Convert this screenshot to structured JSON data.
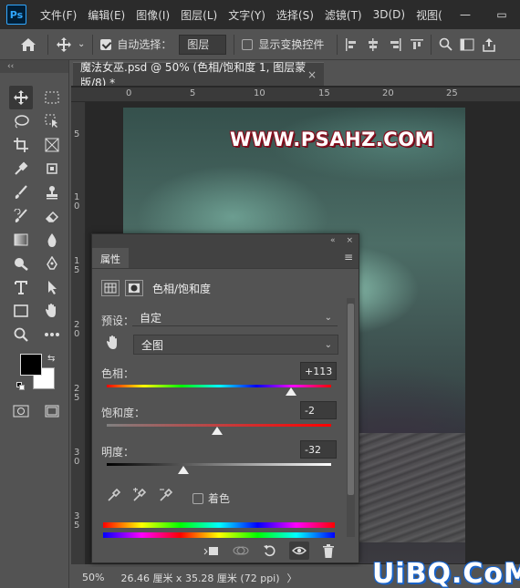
{
  "app": {
    "logo": "Ps"
  },
  "menu": [
    "文件(F)",
    "编辑(E)",
    "图像(I)",
    "图层(L)",
    "文字(Y)",
    "选择(S)",
    "滤镜(T)",
    "3D(D)",
    "视图("
  ],
  "window": {
    "minimize": "—",
    "maximize": "▭"
  },
  "options": {
    "auto_select_label": "自动选择：",
    "auto_select_value": "图层",
    "show_transform_label": "显示变换控件"
  },
  "document": {
    "tab_title": "魔法女巫.psd @ 50% (色相/饱和度 1, 图层蒙版/8) *",
    "close": "×"
  },
  "rulers": {
    "top": [
      "0",
      "5",
      "10",
      "15",
      "20",
      "25"
    ],
    "left": [
      "5",
      "1\n0",
      "1\n5",
      "2\n0",
      "2\n5",
      "3\n0",
      "3\n5"
    ]
  },
  "canvas": {
    "watermark": "WWW.PSAHZ.COM"
  },
  "status": {
    "zoom": "50%",
    "doc_size": "26.46 厘米 x 35.28 厘米 (72 ppi)",
    "arrow": "〉"
  },
  "overlay_watermark": "UiBQ.CoM",
  "properties": {
    "tab_label": "属性",
    "collapse": "«",
    "close": "×",
    "menu": "≡",
    "adjustment_title": "色相/饱和度",
    "preset_label": "预设：",
    "preset_value": "自定",
    "channel_value": "全图",
    "hue_label": "色相：",
    "hue_value": "+113",
    "saturation_label": "饱和度：",
    "saturation_value": "-2",
    "lightness_label": "明度：",
    "lightness_value": "-32",
    "colorize_label": "着色",
    "sliders": {
      "hue_fraction": 0.82,
      "saturation_fraction": 0.49,
      "lightness_fraction": 0.34
    }
  },
  "colors": {
    "accent": "#31a8ff",
    "watermark_red": "#8b1020",
    "watermark_blue": "#1a63c7"
  }
}
